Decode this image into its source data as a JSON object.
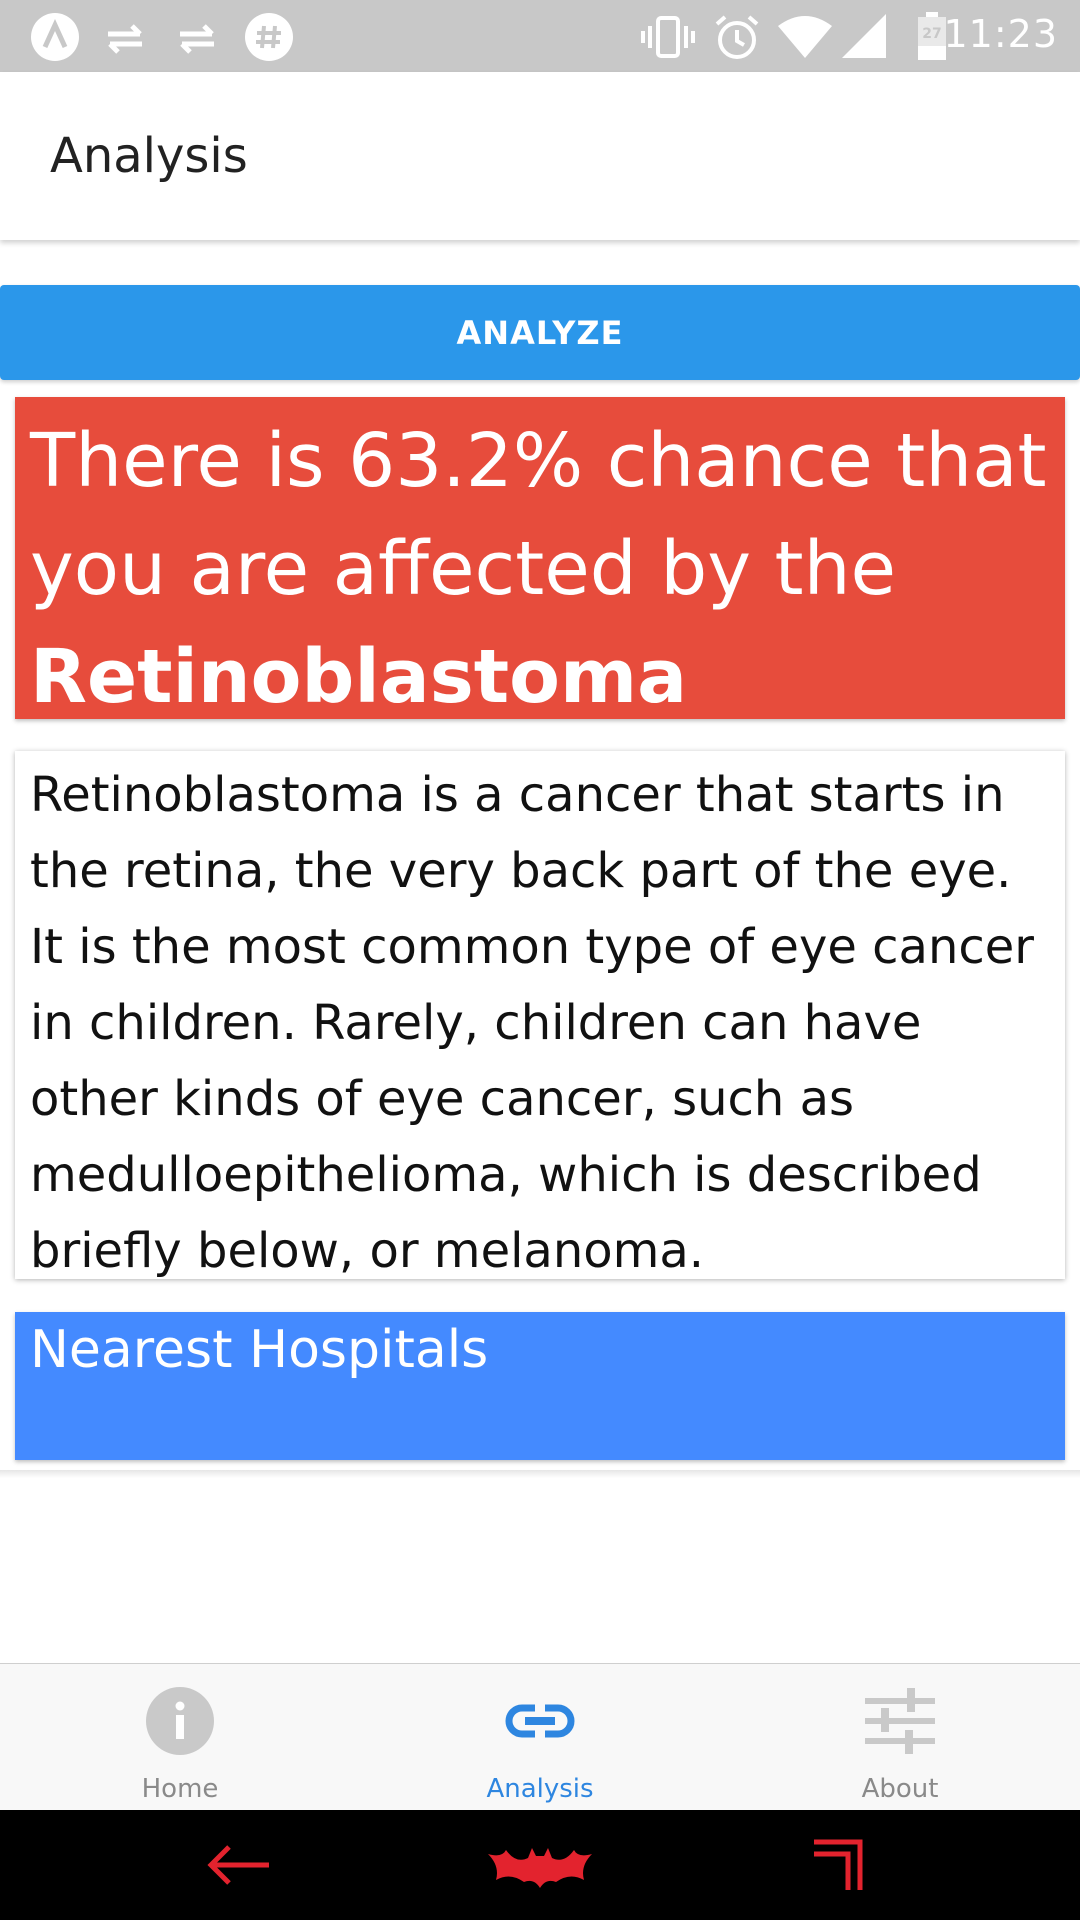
{
  "status_bar": {
    "time": "11:23",
    "left_icons": [
      "a-logo-icon",
      "sync-icon",
      "sync-icon",
      "slack-icon"
    ],
    "right_icons": [
      "vibrate-icon",
      "alarm-icon",
      "wifi-icon",
      "signal-icon",
      "battery-icon"
    ],
    "battery_level": "27"
  },
  "app_bar": {
    "title": "Analysis"
  },
  "analyze_button": {
    "label": "ANALYZE",
    "color": "#2b97ea"
  },
  "result": {
    "prefix": "There is 63.2% chance that you are affected by the",
    "disease": "Retinoblastoma",
    "color": "#e74c3c"
  },
  "description": {
    "text": "Retinoblastoma is a cancer that starts in the retina, the very back part of the eye. It is the most common type of eye cancer in children. Rarely, children can have other kinds of eye cancer, such as medulloepithelioma, which is described briefly below, or melanoma."
  },
  "hospitals": {
    "title": "Nearest Hospitals",
    "color": "#448aff"
  },
  "tabs": [
    {
      "label": "Home",
      "icon": "info-icon",
      "active": false
    },
    {
      "label": "Analysis",
      "icon": "link-icon",
      "active": true
    },
    {
      "label": "About",
      "icon": "sliders-icon",
      "active": false
    }
  ],
  "nav_bar": {
    "icons": [
      "back-icon",
      "batman-home-icon",
      "recents-icon"
    ],
    "color": "#e3232e"
  }
}
